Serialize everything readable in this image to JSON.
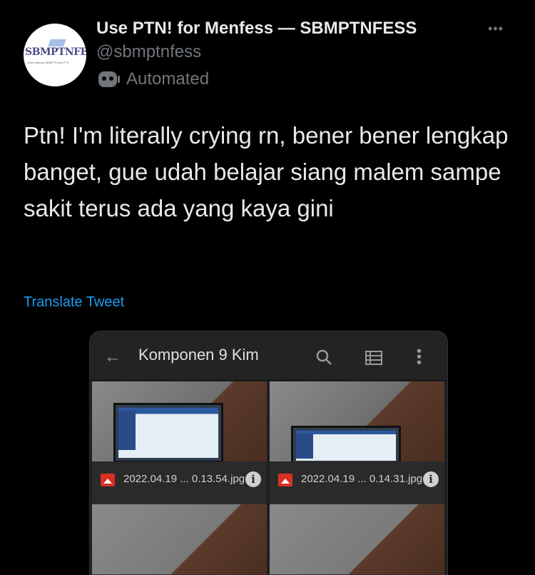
{
  "account": {
    "display_name": "Use PTN! for Menfess — SBMPTNFESS",
    "handle": "@sbmptnfess",
    "automated_label": "Automated",
    "avatar_logo_text": "SBMPTNFESS",
    "avatar_logo_subtext": "base seputar SBMPTN dan PTN"
  },
  "more_label": "•••",
  "tweet": {
    "text": "Ptn! I'm literally crying rn, bener bener lengkap banget, gue udah belajar siang malem sampe sakit terus ada yang kaya gini",
    "translate_label": "Translate Tweet"
  },
  "media": {
    "folder_title": "Komponen 9 Kim",
    "files": [
      {
        "name": "2022.04.19 ... 0.13.54.jpg"
      },
      {
        "name": "2022.04.19 ... 0.14.31.jpg"
      }
    ]
  },
  "icons": [
    "robot-icon",
    "back-arrow-icon",
    "search-icon",
    "list-view-icon",
    "more-vert-icon",
    "image-file-icon",
    "info-icon"
  ],
  "colors": {
    "background": "#000000",
    "link": "#1d9bf0",
    "secondary_text": "#71767b"
  }
}
